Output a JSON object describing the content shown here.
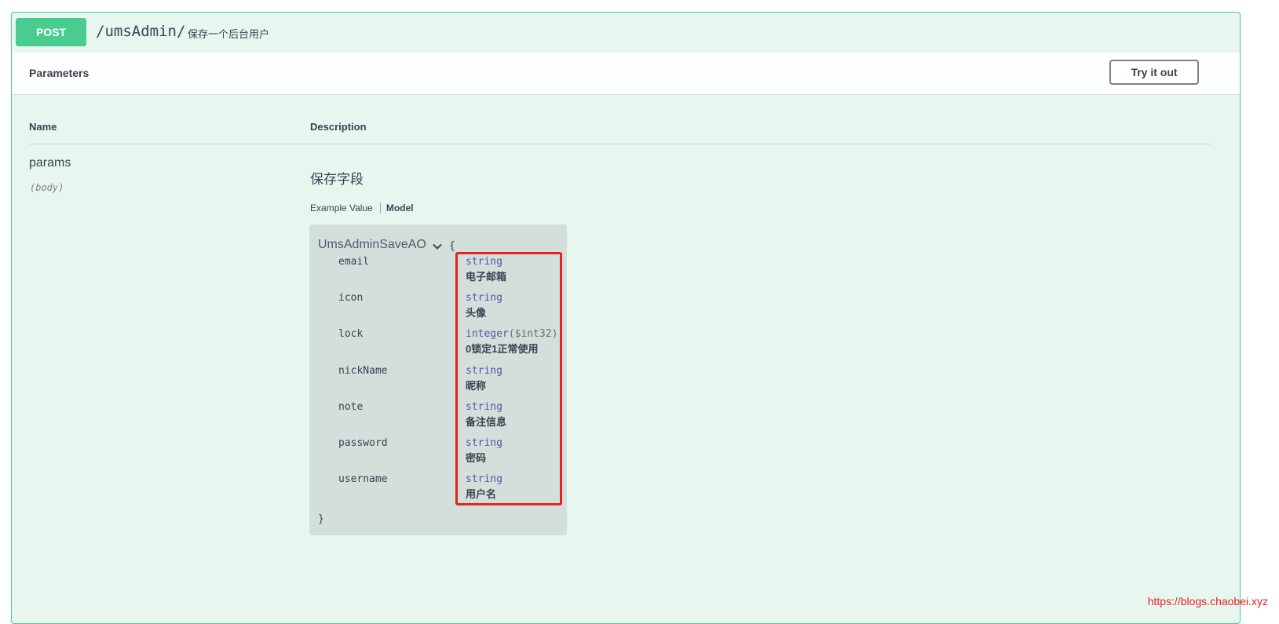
{
  "operation": {
    "method": "POST",
    "path": "/umsAdmin/",
    "summary": "保存一个后台用户"
  },
  "parameters_section": {
    "title": "Parameters",
    "try_button": "Try it out",
    "columns": {
      "name": "Name",
      "description": "Description"
    }
  },
  "param": {
    "name": "params",
    "location": "(body)",
    "description": "保存字段",
    "tabs": {
      "example": "Example Value",
      "model": "Model"
    }
  },
  "model": {
    "name": "UmsAdminSaveAO",
    "open_brace": "{",
    "close_brace": "}",
    "properties": [
      {
        "name": "email",
        "type": "string",
        "format": "",
        "description": "电子邮箱"
      },
      {
        "name": "icon",
        "type": "string",
        "format": "",
        "description": "头像"
      },
      {
        "name": "lock",
        "type": "integer",
        "format": "($int32)",
        "description": "0锁定1正常使用"
      },
      {
        "name": "nickName",
        "type": "string",
        "format": "",
        "description": "昵称"
      },
      {
        "name": "note",
        "type": "string",
        "format": "",
        "description": "备注信息"
      },
      {
        "name": "password",
        "type": "string",
        "format": "",
        "description": "密码"
      },
      {
        "name": "username",
        "type": "string",
        "format": "",
        "description": "用户名"
      }
    ]
  },
  "colors": {
    "post": "#49cc90",
    "highlight": "#e8231f",
    "watermark": "#e82020"
  },
  "watermark": "https://blogs.chaobei.xyz"
}
